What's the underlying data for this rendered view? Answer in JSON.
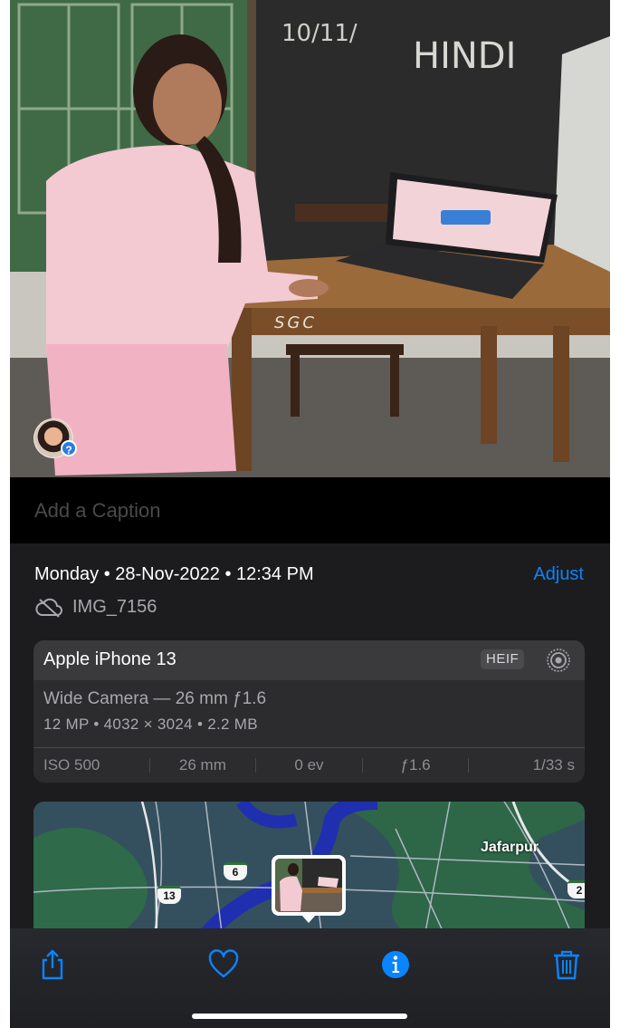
{
  "photo": {
    "board_text_top": "10/11/",
    "board_text_subject": "HINDI",
    "desk_label": "SGC",
    "face_badge": "?"
  },
  "caption": {
    "placeholder": "Add a Caption"
  },
  "info": {
    "date": "Monday • 28-Nov-2022 • 12:34 PM",
    "adjust_label": "Adjust",
    "filename": "IMG_7156",
    "icon": "cloud-slash-icon"
  },
  "camera": {
    "model": "Apple iPhone 13",
    "format_badge": "HEIF",
    "lens": "Wide Camera — 26 mm ƒ1.6",
    "specs": "12 MP • 4032 × 3024 • 2.2 MB",
    "exif": [
      "ISO 500",
      "26 mm",
      "0 ev",
      "ƒ1.6",
      "1/33 s"
    ]
  },
  "map": {
    "place_label": "Jafarpur",
    "route_badges": [
      "13",
      "6",
      "2"
    ]
  },
  "toolbar": {
    "items": [
      "share-icon",
      "heart-icon",
      "info-icon",
      "trash-icon"
    ],
    "accent_color": "#0a84ff"
  }
}
